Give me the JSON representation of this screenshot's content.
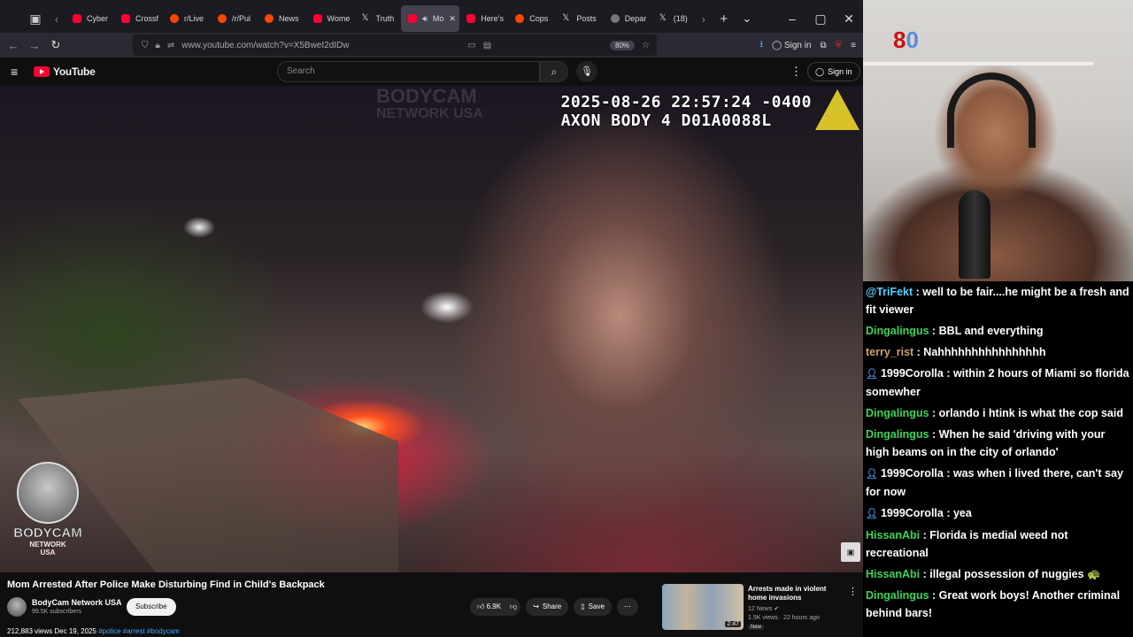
{
  "browser": {
    "tabs": [
      {
        "label": "Cyber",
        "fav": "yt"
      },
      {
        "label": "Crossf",
        "fav": "yt"
      },
      {
        "label": "r/Live",
        "fav": "rd"
      },
      {
        "label": "/r/Pul",
        "fav": "rd"
      },
      {
        "label": "News",
        "fav": "rd"
      },
      {
        "label": "Wome",
        "fav": "yt"
      },
      {
        "label": "Truth",
        "fav": "x"
      },
      {
        "label": "Mo",
        "fav": "yt",
        "active": true
      },
      {
        "label": "Here's",
        "fav": "yt"
      },
      {
        "label": "Cops",
        "fav": "rd"
      },
      {
        "label": "Posts",
        "fav": "x"
      },
      {
        "label": "Depar",
        "fav": "gh"
      },
      {
        "label": "(18)",
        "fav": "x"
      }
    ],
    "url": "www.youtube.com/watch?v=X5BweI2dIDw",
    "zoom": "80%",
    "sign_in": "Sign in",
    "icons": [
      "back-icon",
      "forward-icon",
      "reload-icon",
      "shield-icon",
      "lock-icon",
      "download-icon",
      "extensions-icon",
      "menu-icon"
    ]
  },
  "youtube": {
    "logo_text": "YouTube",
    "search_placeholder": "Search",
    "sign_in": "Sign in"
  },
  "video": {
    "timestamp_line1": "2025-08-26 22:57:24 -0400",
    "timestamp_line2": "AXON BODY 4 D01A0088L",
    "watermark_line1": "BODYCAM",
    "watermark_line2": "NETWORK USA",
    "logo_line1": "BODYCAM",
    "logo_line2": "NETWORK",
    "logo_line3": "USA"
  },
  "info": {
    "title": "Mom Arrested After Police Make Disturbing Find in Child's Backpack",
    "channel": "BodyCam Network USA",
    "subscribers": "99.5K subscribers",
    "subscribe": "Subscribe",
    "likes": "6.9K",
    "share": "Share",
    "save": "Save",
    "views_date": "212,883 views  Dec 19, 2025",
    "tags": "#police #arrest #bodycam"
  },
  "recommended": {
    "title": "Arrests made in violent home invasions",
    "channel": "12 News",
    "meta": "1.5K views · 22 hours ago",
    "badge": "New",
    "duration": "2:47"
  },
  "stream": {
    "counter_prefix": "8",
    "counter_value": "0"
  },
  "chat": [
    {
      "user": "@TriFekt",
      "user_color": "#4fd1ff",
      "badge": false,
      "text": " : well to be fair....he might be a fresh and fit viewer"
    },
    {
      "user": "Dingalingus",
      "user_color": "#3cd55b",
      "badge": false,
      "text": " : BBL and everything"
    },
    {
      "user": "terry_rist",
      "user_color": "#c9a56a",
      "badge": false,
      "text": " : Nahhhhhhhhhhhhhhhh"
    },
    {
      "user": "1999Corolla",
      "user_color": "#ffffff",
      "badge": true,
      "text": " : within 2 hours of Miami so florida somewher"
    },
    {
      "user": "Dingalingus",
      "user_color": "#3cd55b",
      "badge": false,
      "text": " : orlando i htink is what the cop said"
    },
    {
      "user": "Dingalingus",
      "user_color": "#3cd55b",
      "badge": false,
      "text": " : When he said 'driving with your high beams on in the city of orlando'"
    },
    {
      "user": "1999Corolla",
      "user_color": "#ffffff",
      "badge": true,
      "text": " : was when i lived there, can't say for now"
    },
    {
      "user": "1999Corolla",
      "user_color": "#ffffff",
      "badge": true,
      "text": " : yea"
    },
    {
      "user": "HissanAbi",
      "user_color": "#3cd55b",
      "badge": false,
      "text": " : Florida is medial weed not recreational"
    },
    {
      "user": "HissanAbi",
      "user_color": "#3cd55b",
      "badge": false,
      "text": " : illegal possession of nuggies 🐢"
    },
    {
      "user": "Dingalingus",
      "user_color": "#3cd55b",
      "badge": false,
      "text": " : Great work boys! Another criminal behind bars!"
    }
  ]
}
